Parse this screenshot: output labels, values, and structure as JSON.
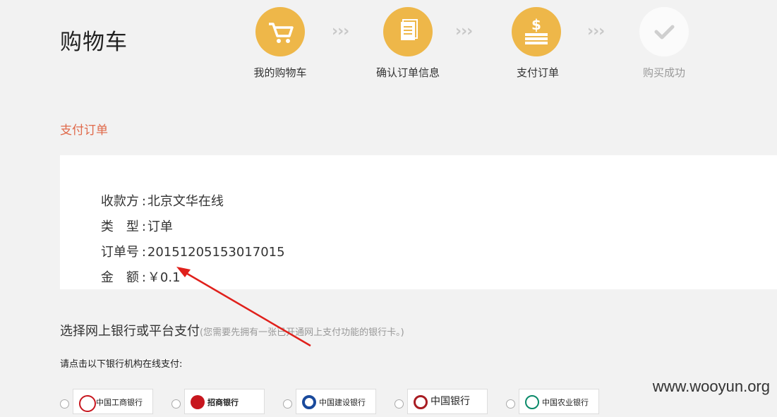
{
  "page_title": "购物车",
  "steps": [
    {
      "label": "我的购物车",
      "icon": "cart-icon",
      "state": "active"
    },
    {
      "label": "确认订单信息",
      "icon": "document-icon",
      "state": "active"
    },
    {
      "label": "支付订单",
      "icon": "money-icon",
      "state": "active"
    },
    {
      "label": "购买成功",
      "icon": "check-icon",
      "state": "pending"
    }
  ],
  "step_separator": "›››",
  "section_title": "支付订单",
  "order": {
    "payee_key": "收款方",
    "payee_value": "北京文华在线",
    "type_key": "类　型",
    "type_value": "订单",
    "number_key": "订单号",
    "number_value": "20151205153017015",
    "amount_key": "金　额",
    "amount_value": "￥0.1",
    "colon": ":"
  },
  "payment": {
    "title": "选择网上银行或平台支付",
    "hint": "(您需要先拥有一张已开通网上支付功能的银行卡。)",
    "instruction": "请点击以下银行机构在线支付:",
    "banks": [
      {
        "name": "中国工商银行",
        "color": "#c7161e"
      },
      {
        "name": "招商银行",
        "color": "#c7161e"
      },
      {
        "name": "中国建设银行",
        "color": "#1a4a9c"
      },
      {
        "name": "中国银行",
        "color": "#a81c22"
      },
      {
        "name": "中国农业银行",
        "color": "#0b8a6a"
      }
    ]
  },
  "watermark": "www.wooyun.org",
  "colors": {
    "accent": "#eeb749",
    "section_title": "#e0694a",
    "arrow": "#e0201b"
  }
}
